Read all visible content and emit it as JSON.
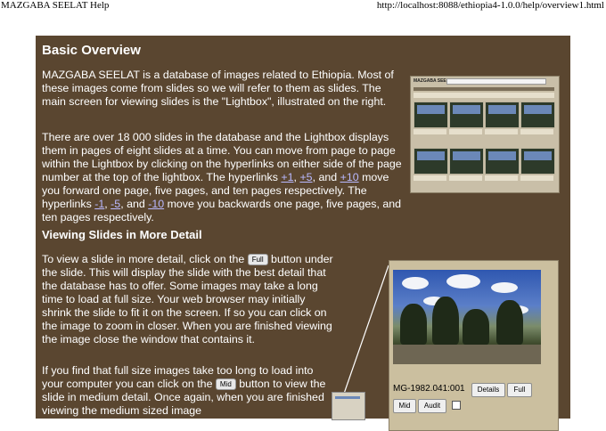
{
  "window": {
    "title": "MAZGABA SEELAT Help",
    "url": "http://localhost:8088/ethiopia4-1.0.0/help/overview1.html"
  },
  "content": {
    "heading": "Basic Overview",
    "para1": "MAZGABA SEELAT is a database of images related to Ethiopia. Most of these images come from slides so we will refer to them as slides. The main screen for viewing slides is the \"Lightbox\", illustrated on the right.",
    "para2": {
      "part1": "There are over 18 000 slides in the database and the Lightbox displays them in pages of eight slides at a time. You can move from page to page within the Lightbox by clicking on the hyperlinks on either side of the page number at the top of the lightbox. The hyperlinks ",
      "link_p1": "+1",
      "sep1": ", ",
      "link_p5": "+5",
      "sep2": ", and ",
      "link_p10": "+10",
      "part2": " move you forward one page, five pages, and ten pages respectively. The hyperlinks ",
      "link_m1": "-1",
      "sep3": ", ",
      "link_m5": "-5",
      "sep4": ", and ",
      "link_m10": "-10",
      "part3": " move you backwards one page, five pages, and ten pages respectively."
    },
    "subheading": "Viewing Slides in More Detail",
    "para3": {
      "before": "To view a slide in more detail, click on the ",
      "button": "Full",
      "after": " button under the slide. This will display the slide with the best detail that the database has to offer. Some images may take a long time to load at full size. Your web browser may initially shrink the slide to fit it on the screen. If so you can click on the image to zoom in closer. When you are finished viewing the image close the window that contains it."
    },
    "para4": {
      "before": "If you find that full size images take too long to load into your computer you can click on the ",
      "button": "Mid",
      "after": " button to view the slide in medium detail. Once again, when you are finished viewing the medium sized image"
    }
  },
  "lightbox_shot": {
    "title": "MAZGABA SEELAT"
  },
  "detail_shot": {
    "slide_id": "MG-1982.041:001",
    "buttons": {
      "details": "Details",
      "full": "Full",
      "mid": "Mid",
      "audit": "Audit"
    }
  },
  "colors": {
    "panel_bg": "#5a4630",
    "link": "#b9b9ff",
    "text": "#ffffff"
  }
}
